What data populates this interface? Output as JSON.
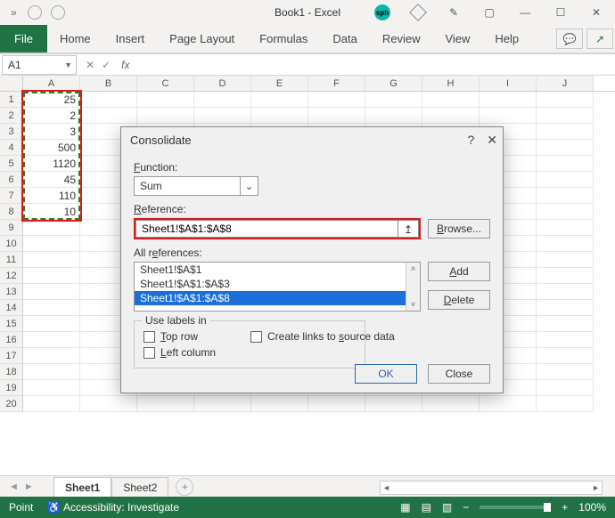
{
  "titlebar": {
    "title": "Book1 - Excel"
  },
  "ribbon": {
    "file": "File",
    "tabs": [
      "Home",
      "Insert",
      "Page Layout",
      "Formulas",
      "Data",
      "Review",
      "View",
      "Help"
    ]
  },
  "namebox": "A1",
  "columns": [
    "A",
    "B",
    "C",
    "D",
    "E",
    "F",
    "G",
    "H",
    "I",
    "J"
  ],
  "rows": [
    1,
    2,
    3,
    4,
    5,
    6,
    7,
    8,
    9,
    10,
    11,
    12,
    13,
    14,
    15,
    16,
    17,
    18,
    19,
    20
  ],
  "cells_A": [
    "25",
    "2",
    "3",
    "500",
    "1120",
    "45",
    "110",
    "10"
  ],
  "sheets": {
    "active": "Sheet1",
    "other": "Sheet2"
  },
  "statusbar": {
    "mode": "Point",
    "accessibility": "Accessibility: Investigate",
    "zoom": "100%"
  },
  "dialog": {
    "title": "Consolidate",
    "function_label": "Function:",
    "function_value": "Sum",
    "reference_label": "Reference:",
    "reference_value": "Sheet1!$A$1:$A$8",
    "browse": "Browse...",
    "allrefs_label": "All references:",
    "allrefs": [
      "Sheet1!$A$1",
      "Sheet1!$A$1:$A$3",
      "Sheet1!$A$1:$A$8"
    ],
    "add": "Add",
    "delete": "Delete",
    "uselabels": "Use labels in",
    "toprow": "Top row",
    "leftcol": "Left column",
    "createlinks": "Create links to source data",
    "ok": "OK",
    "close": "Close"
  }
}
